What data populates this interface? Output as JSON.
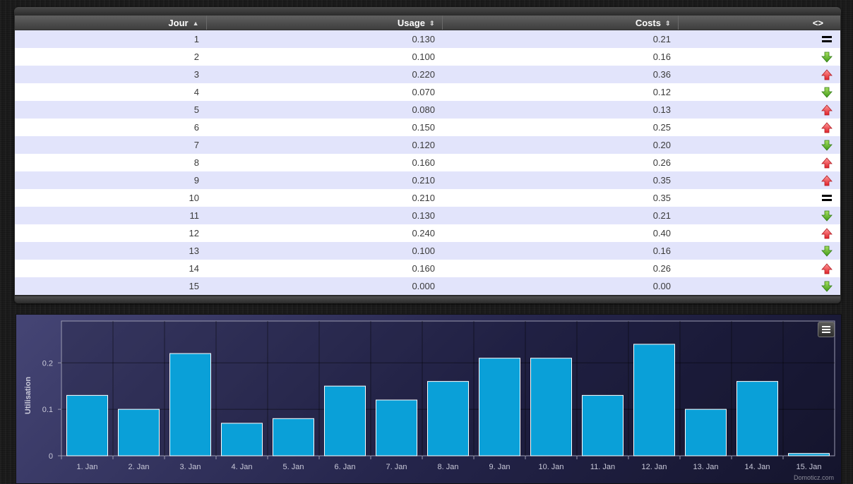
{
  "table": {
    "headers": {
      "day": "Jour",
      "usage": "Usage",
      "costs": "Costs",
      "trend": "<>"
    },
    "sort_icons": {
      "day": "▲",
      "usage": "⇕",
      "costs": "⇕"
    },
    "rows": [
      {
        "day": "1",
        "usage": "0.130",
        "costs": "0.21",
        "trend": "equal"
      },
      {
        "day": "2",
        "usage": "0.100",
        "costs": "0.16",
        "trend": "down"
      },
      {
        "day": "3",
        "usage": "0.220",
        "costs": "0.36",
        "trend": "up"
      },
      {
        "day": "4",
        "usage": "0.070",
        "costs": "0.12",
        "trend": "down"
      },
      {
        "day": "5",
        "usage": "0.080",
        "costs": "0.13",
        "trend": "up"
      },
      {
        "day": "6",
        "usage": "0.150",
        "costs": "0.25",
        "trend": "up"
      },
      {
        "day": "7",
        "usage": "0.120",
        "costs": "0.20",
        "trend": "down"
      },
      {
        "day": "8",
        "usage": "0.160",
        "costs": "0.26",
        "trend": "up"
      },
      {
        "day": "9",
        "usage": "0.210",
        "costs": "0.35",
        "trend": "up"
      },
      {
        "day": "10",
        "usage": "0.210",
        "costs": "0.35",
        "trend": "equal"
      },
      {
        "day": "11",
        "usage": "0.130",
        "costs": "0.21",
        "trend": "down"
      },
      {
        "day": "12",
        "usage": "0.240",
        "costs": "0.40",
        "trend": "up"
      },
      {
        "day": "13",
        "usage": "0.100",
        "costs": "0.16",
        "trend": "down"
      },
      {
        "day": "14",
        "usage": "0.160",
        "costs": "0.26",
        "trend": "up"
      },
      {
        "day": "15",
        "usage": "0.000",
        "costs": "0.00",
        "trend": "down"
      }
    ]
  },
  "chart": {
    "menu_icon": "hamburger-menu-icon",
    "credit": "Domoticz.com",
    "colors": {
      "bar": "#0aa0d8",
      "bar_border": "#ffffff",
      "text": "#c8c8d8"
    }
  },
  "chart_data": {
    "type": "bar",
    "categories": [
      "1. Jan",
      "2. Jan",
      "3. Jan",
      "4. Jan",
      "5. Jan",
      "6. Jan",
      "7. Jan",
      "8. Jan",
      "9. Jan",
      "10. Jan",
      "11. Jan",
      "12. Jan",
      "13. Jan",
      "14. Jan",
      "15. Jan"
    ],
    "values": [
      0.13,
      0.1,
      0.22,
      0.07,
      0.08,
      0.15,
      0.12,
      0.16,
      0.21,
      0.21,
      0.13,
      0.24,
      0.1,
      0.16,
      0.005
    ],
    "ylabel": "Utilisation",
    "ylim": [
      0,
      0.29
    ],
    "yticks": [
      {
        "value": 0,
        "label": "0"
      },
      {
        "value": 0.1,
        "label": "0.1"
      },
      {
        "value": 0.2,
        "label": "0.2"
      }
    ],
    "grid": true,
    "legend": "none"
  }
}
